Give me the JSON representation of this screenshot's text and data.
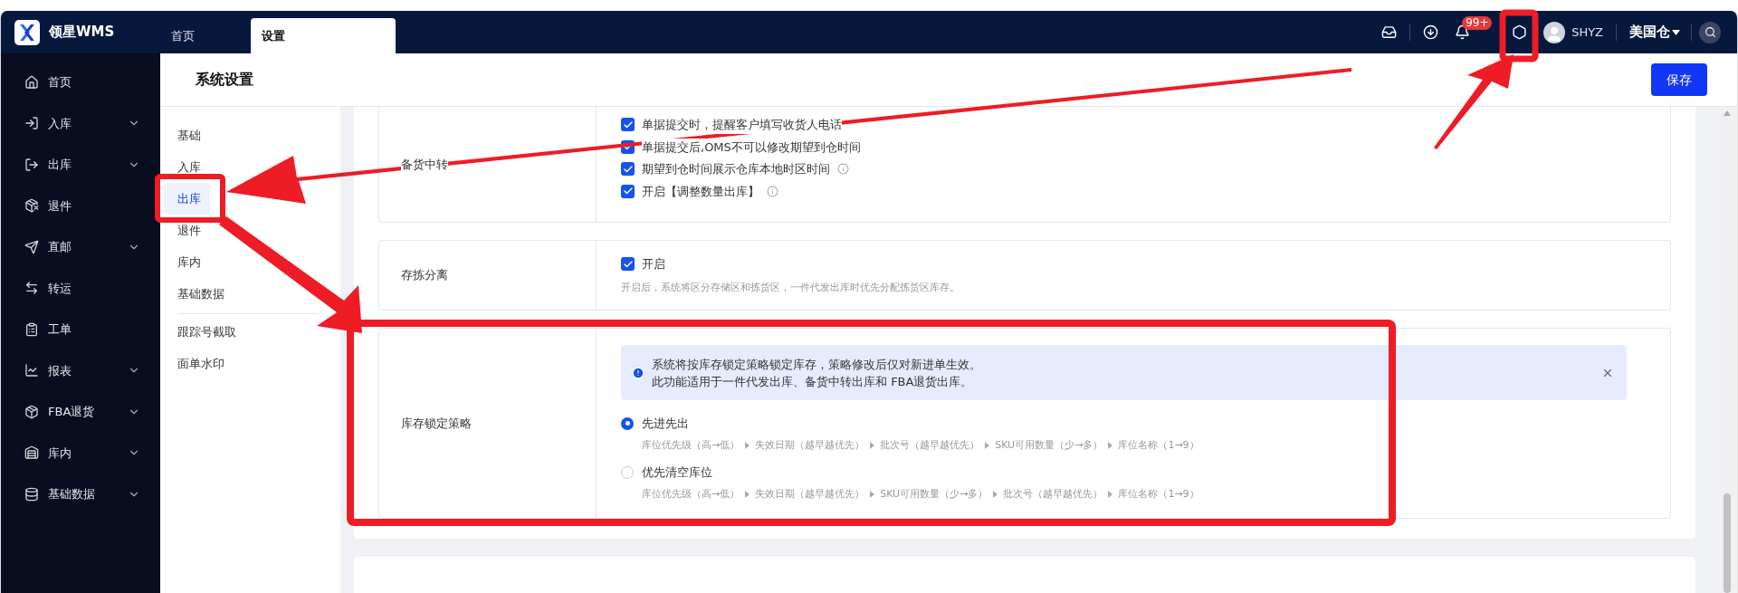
{
  "app": {
    "logo_text": "领星WMS"
  },
  "top_tabs": [
    {
      "label": "首页",
      "selected": false
    },
    {
      "label": "设置",
      "selected": true
    }
  ],
  "header_right": {
    "notification_count": "99+",
    "user": "SHYZ",
    "warehouse": "美国仓"
  },
  "sidebar": [
    {
      "label": "首页",
      "expandable": false
    },
    {
      "label": "入库",
      "expandable": true
    },
    {
      "label": "出库",
      "expandable": true
    },
    {
      "label": "退件",
      "expandable": false
    },
    {
      "label": "直邮",
      "expandable": true
    },
    {
      "label": "转运",
      "expandable": false
    },
    {
      "label": "工单",
      "expandable": false
    },
    {
      "label": "报表",
      "expandable": true
    },
    {
      "label": "FBA退货",
      "expandable": true
    },
    {
      "label": "库内",
      "expandable": true
    },
    {
      "label": "基础数据",
      "expandable": true
    }
  ],
  "page": {
    "title": "系统设置",
    "save_button": "保存"
  },
  "settings_nav": [
    [
      {
        "label": "基础",
        "selected": false
      },
      {
        "label": "入库",
        "selected": false
      },
      {
        "label": "出库",
        "selected": true
      },
      {
        "label": "退件",
        "selected": false
      },
      {
        "label": "库内",
        "selected": false
      },
      {
        "label": "基础数据",
        "selected": false
      }
    ],
    [
      {
        "label": "跟踪号截取",
        "selected": false
      },
      {
        "label": "面单水印",
        "selected": false
      }
    ]
  ],
  "sections": [
    {
      "kind": "checkboxes",
      "label": "备货中转",
      "options": [
        {
          "label": "单据提交时，提醒客户填写收货人电话",
          "checked": true,
          "info": false
        },
        {
          "label": "单据提交后,OMS不可以修改期望到仓时间",
          "checked": true,
          "info": false
        },
        {
          "label": "期望到仓时间展示仓库本地时区时间",
          "checked": true,
          "info": true
        },
        {
          "label": "开启【调整数量出库】",
          "checked": true,
          "info": true
        }
      ]
    },
    {
      "kind": "checkboxes",
      "label": "存拣分离",
      "options": [
        {
          "label": "开启",
          "checked": true,
          "info": false
        }
      ],
      "hint": "开启后，系统将区分存储区和拣货区，一件代发出库时优先分配拣货区库存。"
    },
    {
      "kind": "radios",
      "label": "库存锁定策略",
      "notice": [
        "系统将按库存锁定策略锁定库存，策略修改后仅对新进单生效。",
        "此功能适用于一件代发出库、备货中转出库和 FBA退货出库。"
      ],
      "options": [
        {
          "label": "先进先出",
          "selected": true,
          "steps": [
            "库位优先级（高→低）",
            "失效日期（越早越优先）",
            "批次号（越早越优先）",
            "SKU可用数量（少→多）",
            "库位名称（1→9）"
          ]
        },
        {
          "label": "优先清空库位",
          "selected": false,
          "steps": [
            "库位优先级（高→低）",
            "失效日期（越早越优先）",
            "SKU可用数量（少→多）",
            "批次号（越早越优先）",
            "库位名称（1→9）"
          ]
        }
      ]
    }
  ]
}
